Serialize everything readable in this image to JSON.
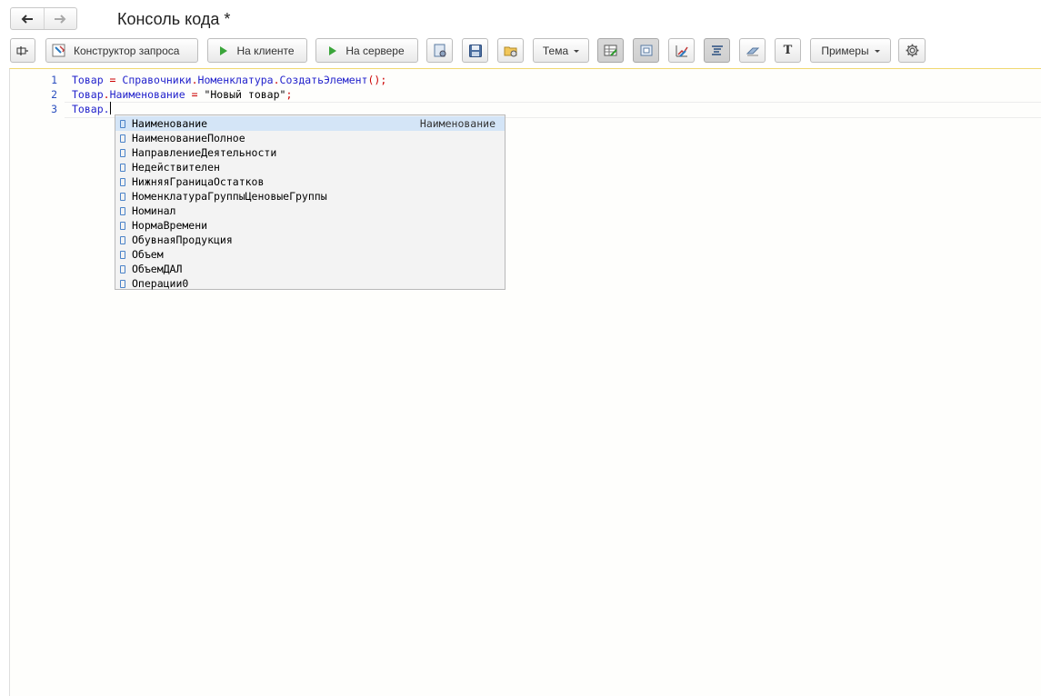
{
  "window": {
    "title": "Консоль кода *"
  },
  "nav": {
    "back_icon": "arrow-left-icon",
    "forward_icon": "arrow-right-icon"
  },
  "toolbar": {
    "query_builder_label": "Конструктор запроса",
    "run_client_label": "На клиенте",
    "run_server_label": "На сервере",
    "theme_label": "Тема",
    "text_label": "T",
    "examples_label": "Примеры"
  },
  "editor": {
    "lines": [
      {
        "num": "1"
      },
      {
        "num": "2"
      },
      {
        "num": "3"
      }
    ],
    "code": {
      "l1_var": "Товар",
      "l1_eq": " = ",
      "l1_obj": "Справочники",
      "l1_dot1": ".",
      "l1_cat": "Номенклатура",
      "l1_dot2": ".",
      "l1_method": "СоздатьЭлемент",
      "l1_tail": "();",
      "l2_var": "Товар",
      "l2_dot": ".",
      "l2_prop": "Наименование",
      "l2_eq": " = ",
      "l2_str": "\"Новый товар\"",
      "l2_tail": ";",
      "l3_var": "Товар",
      "l3_dot": "."
    }
  },
  "autocomplete": {
    "hint": "Наименование",
    "items": [
      "Наименование",
      "НаименованиеПолное",
      "НаправлениеДеятельности",
      "Недействителен",
      "НижняяГраницаОстатков",
      "НоменклатураГруппыЦеновыеГруппы",
      "Номинал",
      "НормаВремени",
      "ОбувнаяПродукция",
      "Объем",
      "ОбъемДАЛ",
      "Операции0"
    ],
    "selected_index": 0
  }
}
